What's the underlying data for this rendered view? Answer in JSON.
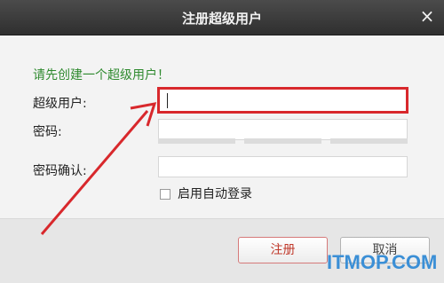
{
  "window": {
    "title": "注册超级用户"
  },
  "form": {
    "prompt": "请先创建一个超级用户！",
    "username_label": "超级用户:",
    "username_value": "",
    "password_label": "密码:",
    "password_value": "",
    "confirm_label": "密码确认:",
    "confirm_value": "",
    "auto_login_label": "启用自动登录",
    "auto_login_checked": false
  },
  "buttons": {
    "ok": "注册",
    "cancel": "取消"
  },
  "watermark": "ITMOP.COM",
  "colors": {
    "annotation": "#d8282c",
    "prompt": "#2f8a2f"
  }
}
